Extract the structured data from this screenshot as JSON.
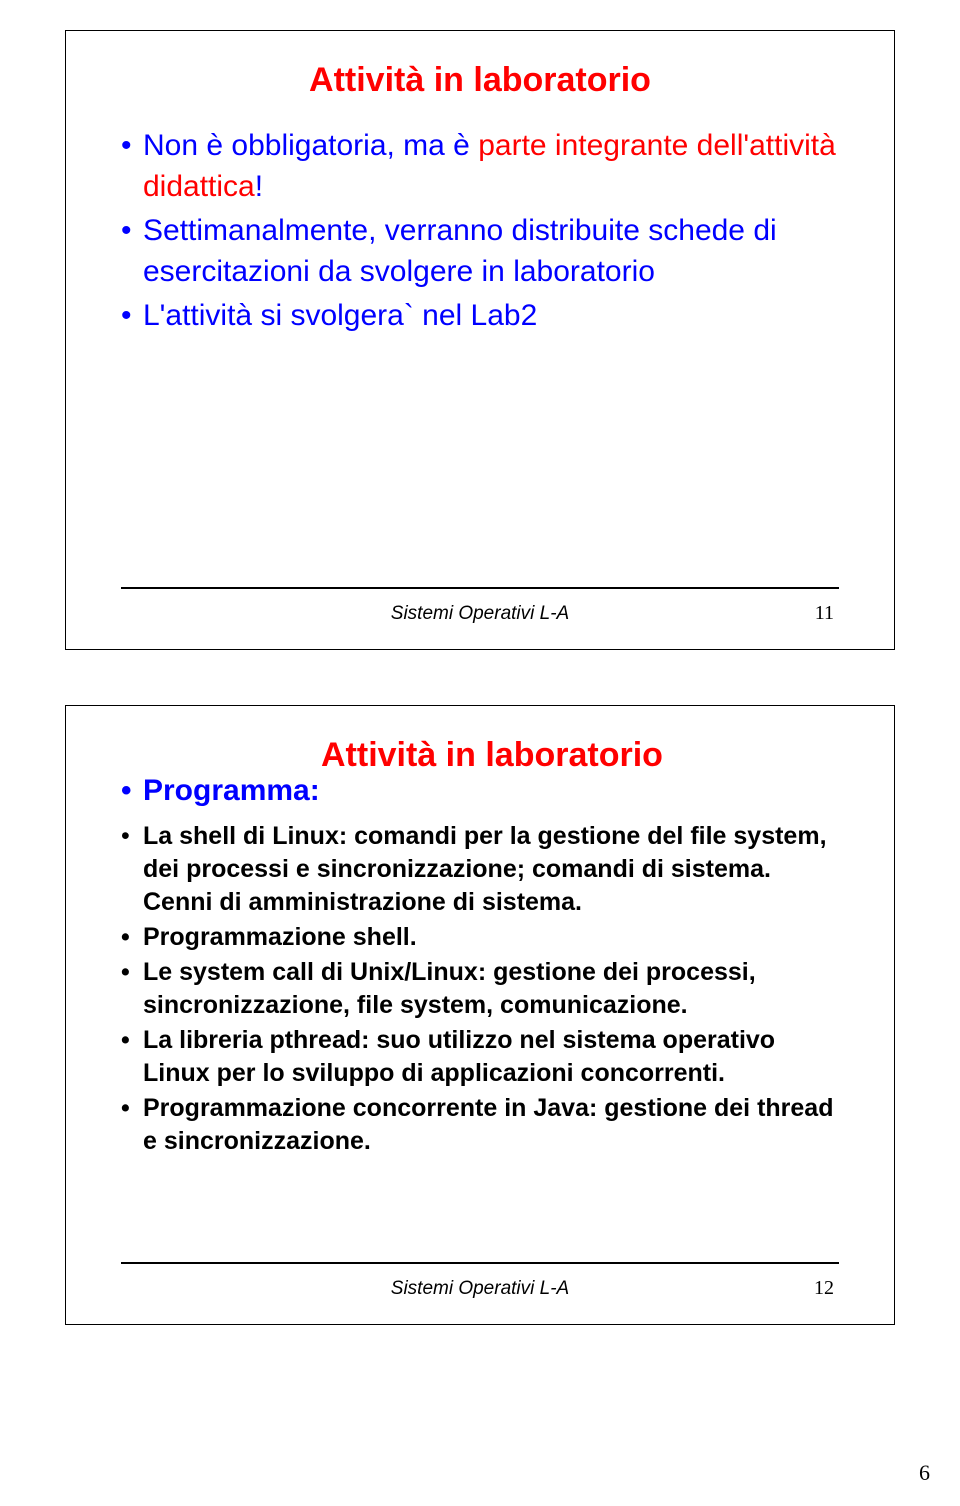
{
  "slide1": {
    "title": "Attività in laboratorio",
    "b1a": "Non è obbligatoria, ma è ",
    "b1b": "parte integrante dell'attività didattica",
    "b1c": "!",
    "b2": "Settimanalmente, verranno distribuite schede di esercitazioni da svolgere in laboratorio",
    "b3": "L'attività si svolgera` nel Lab2",
    "footer": "Sistemi Operativi L-A",
    "num": "11"
  },
  "slide2": {
    "title_red": "Attività in laboratorio",
    "prog": "Programma:",
    "b1a": "La shell di Linux: comandi per la gestione del file system, dei processi e sincronizzazione; comandi di sistema. Cenni di amministrazione di sistema.",
    "b2": "Programmazione shell.",
    "b3": "Le system call di Unix/Linux: gestione dei processi, sincronizzazione, file system, comunicazione.",
    "b4": "La libreria pthread: suo utilizzo nel sistema operativo Linux per lo sviluppo di applicazioni concorrenti.",
    "b5": "Programmazione concorrente in Java: gestione dei thread e sincronizzazione.",
    "footer": "Sistemi Operativi L-A",
    "num": "12"
  },
  "pageNum": "6"
}
